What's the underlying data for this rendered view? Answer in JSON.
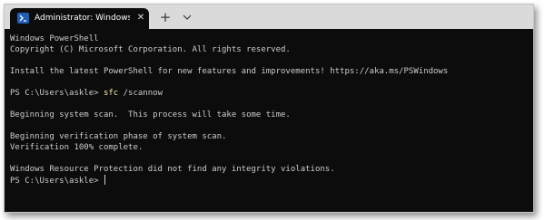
{
  "window": {
    "tab_title": "Administrator: Windows PowerShell",
    "tab_icon": "powershell-icon",
    "close_icon": "close-icon",
    "new_tab_icon": "plus-icon",
    "dropdown_icon": "chevron-down-icon"
  },
  "colors": {
    "terminal_bg": "#0c0c0c",
    "terminal_fg": "#cccccc",
    "command_fg": "#f9f1a5",
    "titlebar_bg": "#dadada"
  },
  "terminal": {
    "header_line1": "Windows PowerShell",
    "header_line2": "Copyright (C) Microsoft Corporation. All rights reserved.",
    "install_line": "Install the latest PowerShell for new features and improvements! https://aka.ms/PSWindows",
    "prompt1": "PS C:\\Users\\askle> ",
    "command": "sfc",
    "command_args": " /scannow",
    "scan_line": "Beginning system scan.  This process will take some time.",
    "verify_line": "Beginning verification phase of system scan.",
    "verify_done": "Verification 100% complete.",
    "result_line": "Windows Resource Protection did not find any integrity violations.",
    "prompt2": "PS C:\\Users\\askle> "
  }
}
